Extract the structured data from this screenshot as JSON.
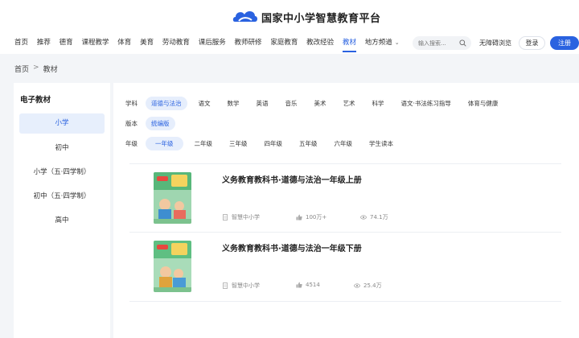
{
  "header": {
    "logo_text": "国家中小学智慧教育平台",
    "nav": [
      {
        "label": "首页"
      },
      {
        "label": "推荐"
      },
      {
        "label": "德育"
      },
      {
        "label": "课程教学"
      },
      {
        "label": "体育"
      },
      {
        "label": "美育"
      },
      {
        "label": "劳动教育"
      },
      {
        "label": "课后服务"
      },
      {
        "label": "教师研修"
      },
      {
        "label": "家庭教育"
      },
      {
        "label": "教改经验"
      },
      {
        "label": "教材"
      },
      {
        "label": "地方频道"
      }
    ],
    "search_placeholder": "输入搜索...",
    "accessibility": "无障碍浏览",
    "login": "登录",
    "register": "注册"
  },
  "breadcrumb": {
    "home": "首页",
    "sep": ">",
    "current": "教材"
  },
  "sidebar": {
    "title": "电子教材",
    "items": [
      {
        "label": "小学"
      },
      {
        "label": "初中"
      },
      {
        "label": "小学（五·四学制）"
      },
      {
        "label": "初中（五·四学制）"
      },
      {
        "label": "高中"
      }
    ]
  },
  "filters": {
    "subject": {
      "label": "学科",
      "options": [
        "道德与法治",
        "语文",
        "数学",
        "英语",
        "音乐",
        "美术",
        "艺术",
        "科学",
        "语文·书法练习指导",
        "体育与健康"
      ]
    },
    "edition": {
      "label": "版本",
      "options": [
        "统编版"
      ]
    },
    "grade": {
      "label": "年级",
      "options": [
        "一年级",
        "二年级",
        "三年级",
        "四年级",
        "五年级",
        "六年级",
        "学生读本"
      ]
    }
  },
  "books": [
    {
      "title": "义务教育教科书·道德与法治一年级上册",
      "publisher": "智慧中小学",
      "likes": "100万+",
      "views": "74.1万"
    },
    {
      "title": "义务教育教科书·道德与法治一年级下册",
      "publisher": "智慧中小学",
      "likes": "4514",
      "views": "25.4万"
    }
  ],
  "colors": {
    "accent": "#2a62e0",
    "background": "#f3f5f8"
  }
}
